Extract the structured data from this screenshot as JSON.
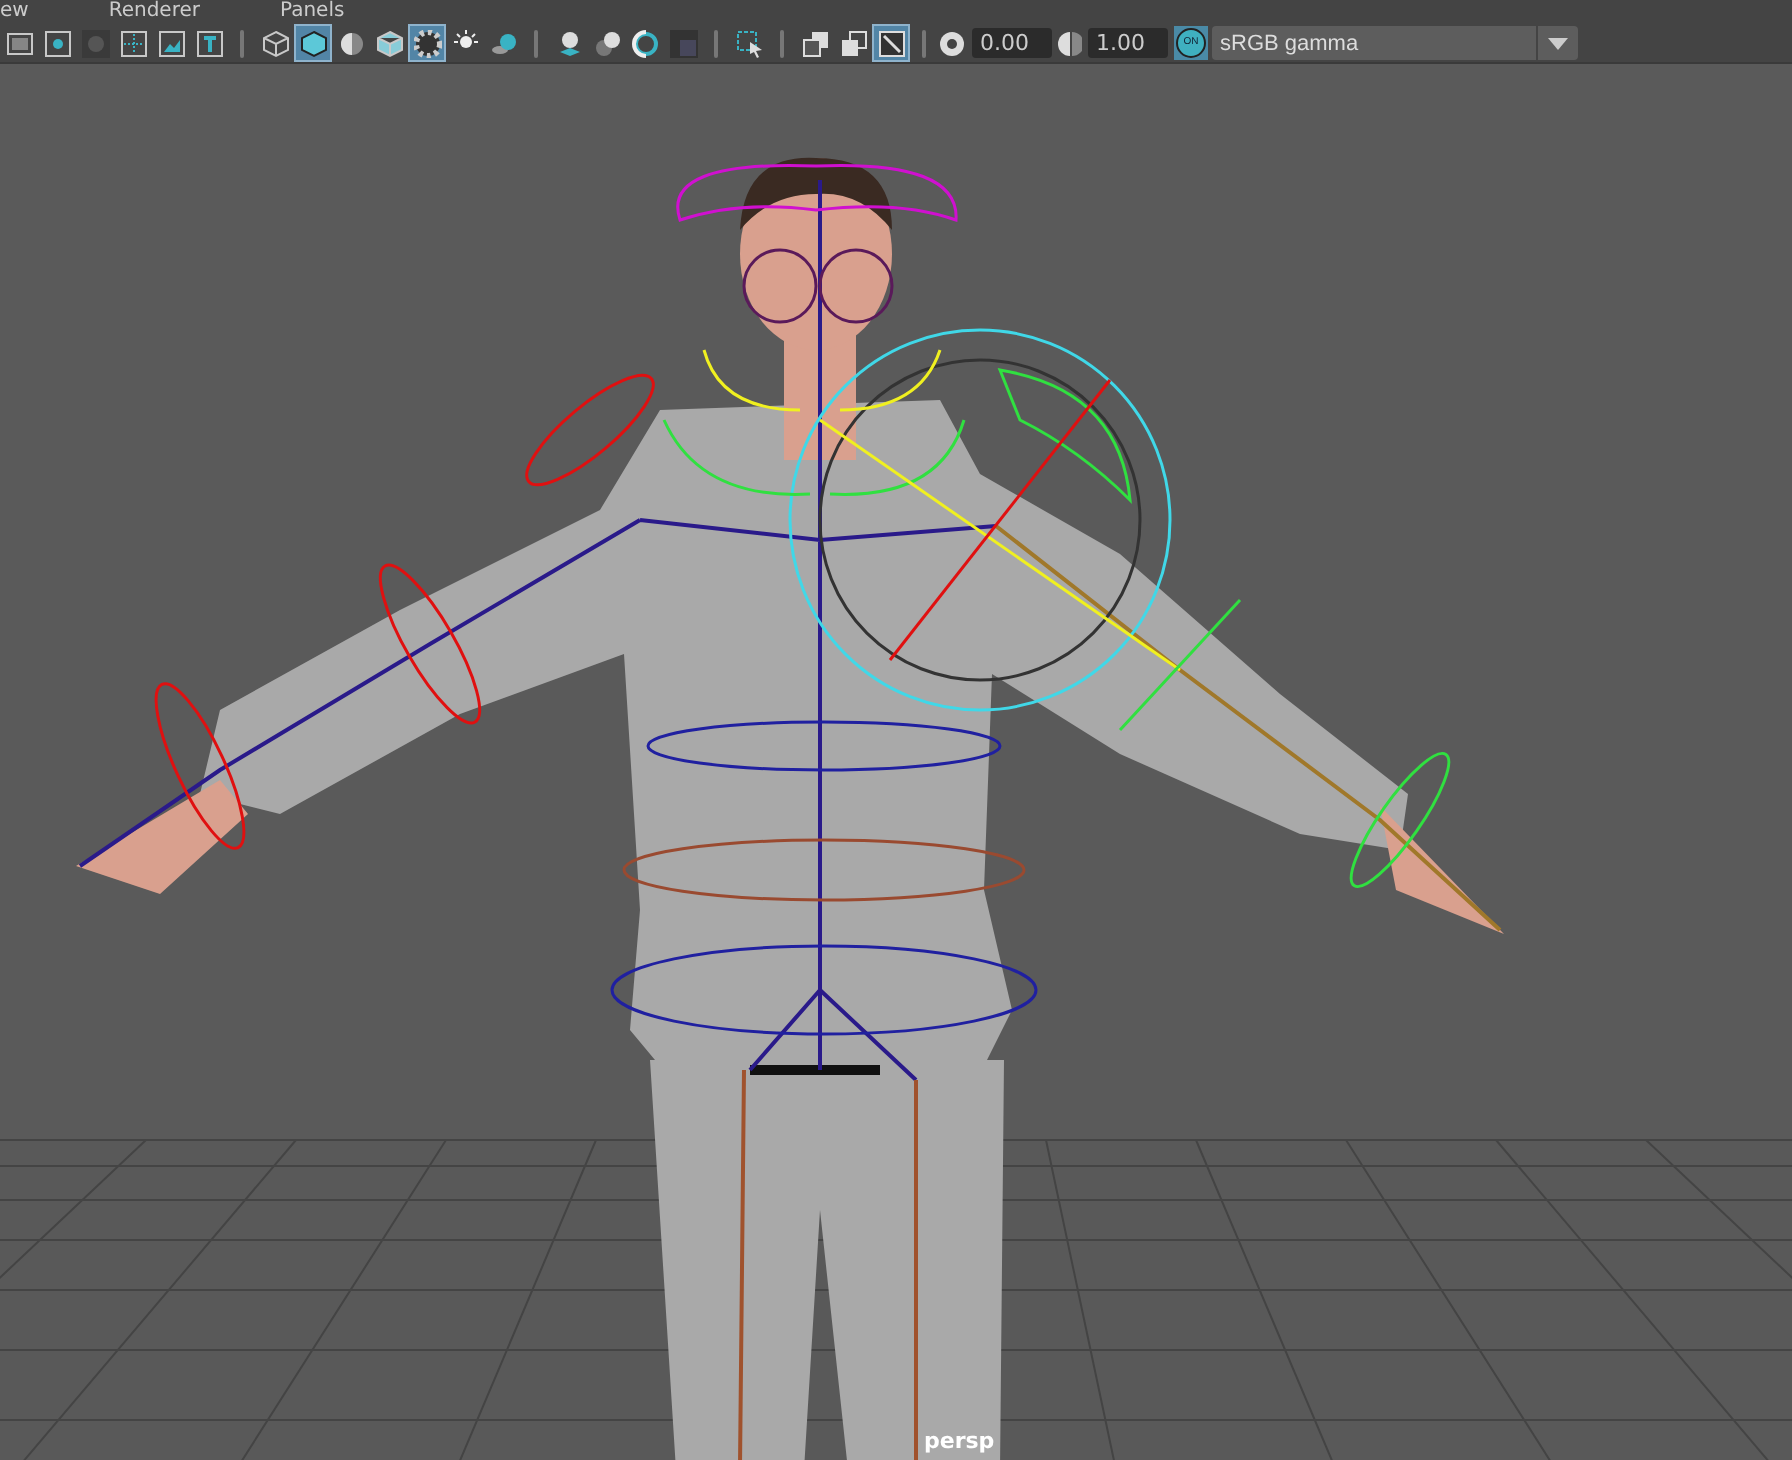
{
  "menu": [
    {
      "label": "ew"
    },
    {
      "label": "Renderer"
    },
    {
      "label": "Panels"
    }
  ],
  "toolbar": {
    "groups": [
      [
        {
          "selected": false
        },
        {
          "selected": false
        },
        {
          "selected": false
        },
        {
          "selected": false
        },
        {
          "selected": false
        },
        {
          "selected": false
        }
      ],
      [
        {
          "selected": false
        },
        {
          "selected": true
        },
        {
          "selected": false
        },
        {
          "selected": false
        },
        {
          "selected": true
        },
        {
          "selected": false
        },
        {
          "selected": false
        }
      ],
      [
        {
          "selected": false
        },
        {
          "selected": false
        },
        {
          "selected": false
        },
        {
          "selected": false
        }
      ],
      [
        {
          "selected": false
        }
      ],
      [
        {
          "selected": false
        },
        {
          "selected": false
        },
        {
          "selected": true
        }
      ]
    ]
  },
  "exposure": {
    "value": "0.00"
  },
  "gamma": {
    "value": "1.00"
  },
  "color_management": {
    "label": "ON",
    "on": true
  },
  "view_transform": {
    "value": "sRGB gamma"
  },
  "viewport": {
    "camera_label": "persp"
  }
}
